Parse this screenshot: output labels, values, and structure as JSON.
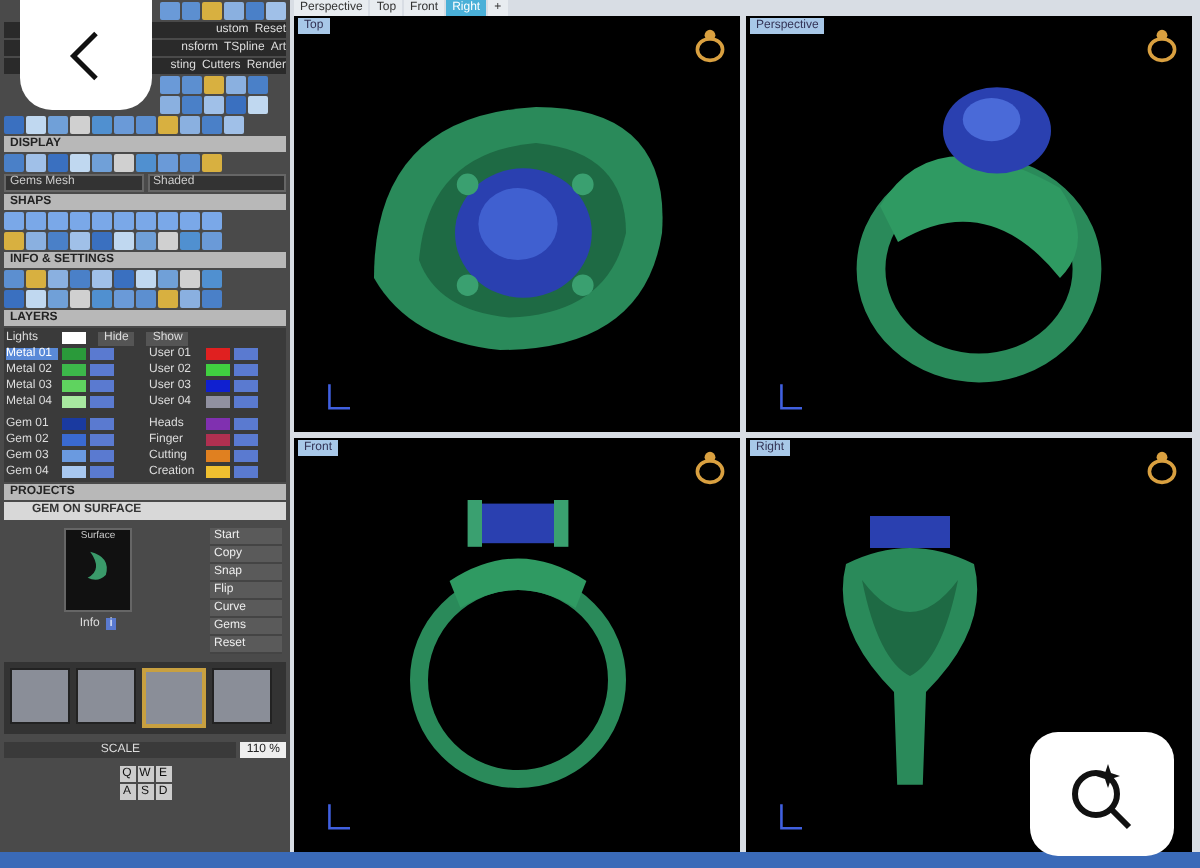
{
  "left_panel": {
    "menu_rows": [
      [
        "ustom",
        "Reset"
      ],
      [
        "nsform",
        "TSpline",
        "Art"
      ],
      [
        "sting",
        "Cutters",
        "Render"
      ]
    ],
    "display": {
      "title": "DISPLAY",
      "dropdowns": [
        "Gems Mesh",
        "Shaded"
      ]
    },
    "shaps": {
      "title": "SHAPS"
    },
    "info": {
      "title": "INFO & SETTINGS"
    },
    "layers": {
      "title": "LAYERS",
      "lights": "Lights",
      "buttons": [
        "Hide",
        "Show"
      ],
      "left": [
        {
          "name": "Metal 01",
          "color": "#2a9a3a",
          "selected": true,
          "visible": true
        },
        {
          "name": "Metal 02",
          "color": "#3cb84a",
          "selected": false,
          "visible": true
        },
        {
          "name": "Metal 03",
          "color": "#5fd35f",
          "selected": false,
          "visible": true
        },
        {
          "name": "Metal 04",
          "color": "#a8e8a0",
          "selected": false,
          "visible": true
        },
        {
          "name": "Gem 01",
          "color": "#1a3aa0",
          "selected": false,
          "visible": true
        },
        {
          "name": "Gem 02",
          "color": "#3a6ad0",
          "selected": false,
          "visible": true
        },
        {
          "name": "Gem 03",
          "color": "#6a9ae0",
          "selected": false,
          "visible": true
        },
        {
          "name": "Gem 04",
          "color": "#a8c8f0",
          "selected": false,
          "visible": true
        }
      ],
      "right": [
        {
          "name": "User 01",
          "color": "#e02020",
          "selected": false,
          "visible": true
        },
        {
          "name": "User 02",
          "color": "#40d040",
          "selected": false,
          "visible": true
        },
        {
          "name": "User 03",
          "color": "#1020d0",
          "selected": false,
          "visible": true
        },
        {
          "name": "User 04",
          "color": "#9090a0",
          "selected": false,
          "visible": true
        },
        {
          "name": "Heads",
          "color": "#8030b0",
          "selected": false,
          "visible": true
        },
        {
          "name": "Finger",
          "color": "#b03050",
          "selected": false,
          "visible": true
        },
        {
          "name": "Cutting",
          "color": "#e08020",
          "selected": false,
          "visible": true
        },
        {
          "name": "Creation",
          "color": "#f0c030",
          "selected": false,
          "visible": true
        }
      ]
    },
    "projects": {
      "title": "PROJECTS",
      "project": "GEM ON SURFACE",
      "preview_label": "Surface",
      "info_label": "Info",
      "info_button": "i",
      "menu": [
        "Start",
        "Copy",
        "Snap",
        "Flip",
        "Curve",
        "Gems",
        "Reset"
      ],
      "thumbnails": [
        {
          "selected": false
        },
        {
          "selected": false
        },
        {
          "selected": true
        },
        {
          "selected": false
        }
      ],
      "scale_label": "SCALE",
      "scale_value": "110 %",
      "keys": [
        [
          "Q",
          "W",
          "E"
        ],
        [
          "A",
          "S",
          "D"
        ]
      ]
    }
  },
  "viewport_tabs": [
    {
      "label": "Perspective",
      "selected": false
    },
    {
      "label": "Top",
      "selected": false
    },
    {
      "label": "Front",
      "selected": false
    },
    {
      "label": "Right",
      "selected": true
    },
    {
      "label": "+",
      "selected": false
    }
  ],
  "viewports": [
    {
      "label": "Top",
      "kind": "top"
    },
    {
      "label": "Perspective",
      "kind": "perspective"
    },
    {
      "label": "Front",
      "kind": "front"
    },
    {
      "label": "Right",
      "kind": "right"
    }
  ]
}
